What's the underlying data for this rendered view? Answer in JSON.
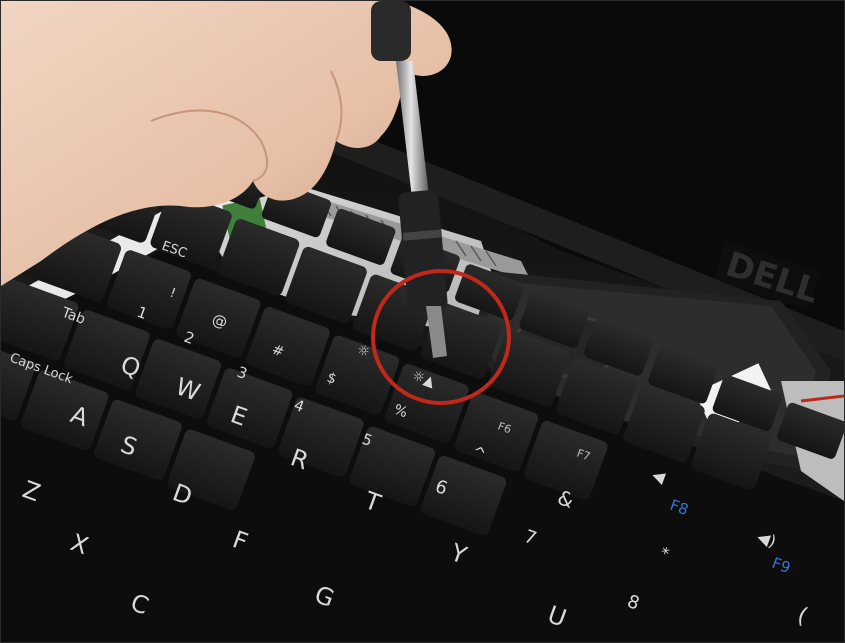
{
  "photo": {
    "subject": "laptop keyboard repair photo",
    "highlight_color": "#c0281c",
    "keys": [
      {
        "id": "esc",
        "label": "ESC"
      },
      {
        "id": "tab",
        "label": "Tab"
      },
      {
        "id": "caps",
        "label": "Caps Lock"
      },
      {
        "id": "q",
        "label": "Q"
      },
      {
        "id": "w",
        "label": "W"
      },
      {
        "id": "e",
        "label": "E"
      },
      {
        "id": "r",
        "label": "R"
      },
      {
        "id": "t",
        "label": "T"
      },
      {
        "id": "y",
        "label": "Y"
      },
      {
        "id": "u",
        "label": "U"
      },
      {
        "id": "a",
        "label": "A"
      },
      {
        "id": "s",
        "label": "S"
      },
      {
        "id": "d",
        "label": "D"
      },
      {
        "id": "f",
        "label": "F"
      },
      {
        "id": "g",
        "label": "G"
      },
      {
        "id": "z",
        "label": "Z"
      },
      {
        "id": "x",
        "label": "X"
      },
      {
        "id": "c",
        "label": "C"
      },
      {
        "id": "n1",
        "label": "1"
      },
      {
        "id": "n2",
        "label": "2"
      },
      {
        "id": "n3",
        "label": "3"
      },
      {
        "id": "n4",
        "label": "4"
      },
      {
        "id": "n5",
        "label": "5"
      },
      {
        "id": "n6",
        "label": "6"
      },
      {
        "id": "n7",
        "label": "7"
      },
      {
        "id": "n8",
        "label": "8"
      },
      {
        "id": "f6",
        "label": "F6"
      },
      {
        "id": "f7",
        "label": "F7"
      },
      {
        "id": "f8",
        "label": "F8"
      },
      {
        "id": "f9",
        "label": "F9"
      }
    ],
    "symbols": {
      "at": "@",
      "hash": "#",
      "dollar": "$",
      "percent": "%",
      "caret": "^",
      "amp": "&",
      "star": "*",
      "paren": "(",
      "bang": "!"
    },
    "brand_logo": "DELL"
  }
}
